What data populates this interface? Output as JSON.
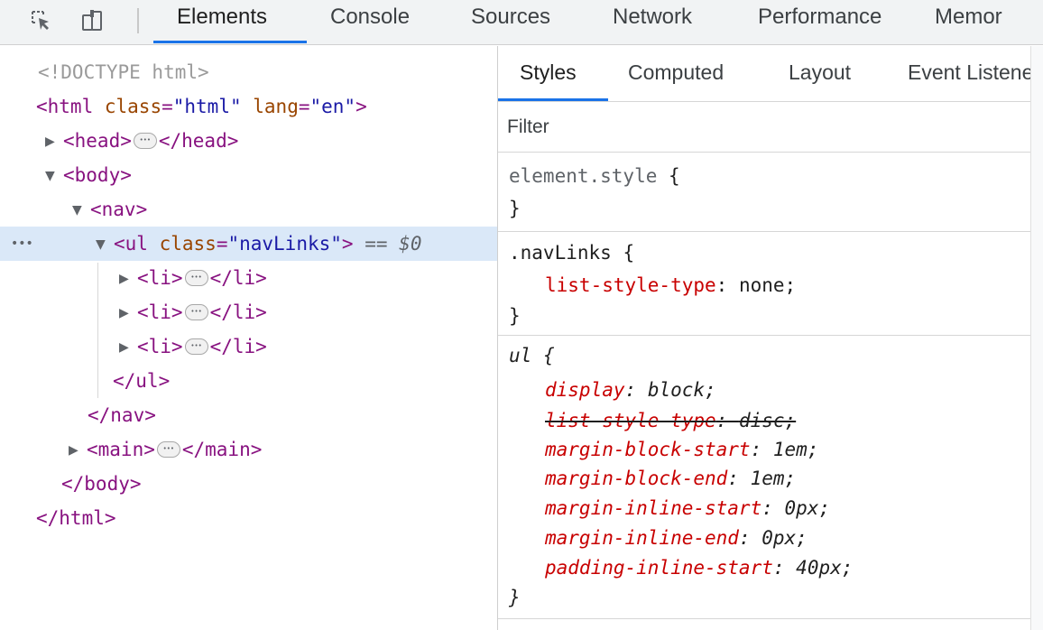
{
  "toolbar": {
    "tabs": [
      {
        "label": "Elements",
        "active": true
      },
      {
        "label": "Console"
      },
      {
        "label": "Sources"
      },
      {
        "label": "Network"
      },
      {
        "label": "Performance"
      },
      {
        "label": "Memor"
      }
    ],
    "icons": [
      "inspect-element-icon",
      "device-toolbar-icon"
    ]
  },
  "dom": {
    "doctype": "<!DOCTYPE html>",
    "html_open_tag": "<html",
    "html_attr_class": "class",
    "html_class_val": "\"html\"",
    "html_attr_lang": "lang",
    "html_lang_val": "\"en\"",
    "gt": ">",
    "head_open": "<head>",
    "head_close": "</head>",
    "body_open": "<body>",
    "nav_open": "<nav>",
    "ul_open": "<ul",
    "ul_attr_class": "class",
    "ul_class_val": "\"navLinks\"",
    "selected_marker_eq": "==",
    "selected_marker_var": "$0",
    "li_open": "<li>",
    "li_close": "</li>",
    "ul_close": "</ul>",
    "nav_close": "</nav>",
    "main_open": "<main>",
    "main_close": "</main>",
    "body_close": "</body>",
    "html_close": "</html>",
    "gutter_dots": "•••"
  },
  "styles": {
    "subtabs": [
      {
        "label": "Styles",
        "active": true
      },
      {
        "label": "Computed"
      },
      {
        "label": "Layout"
      },
      {
        "label": "Event Listeners"
      }
    ],
    "filter_placeholder": "Filter",
    "rules": {
      "element_style_selector": "element.style",
      "open_brace": "{",
      "close_brace": "}",
      "navlinks_selector": ".navLinks",
      "navlinks_prop": "list-style-type",
      "navlinks_val": "none;",
      "ul_selector": "ul",
      "ul_props": [
        {
          "name": "display",
          "value": "block;",
          "struck": false
        },
        {
          "name": "list-style-type",
          "value": "disc;",
          "struck": true
        },
        {
          "name": "margin-block-start",
          "value": "1em;",
          "struck": false
        },
        {
          "name": "margin-block-end",
          "value": "1em;",
          "struck": false
        },
        {
          "name": "margin-inline-start",
          "value": "0px;",
          "struck": false
        },
        {
          "name": "margin-inline-end",
          "value": "0px;",
          "struck": false
        },
        {
          "name": "padding-inline-start",
          "value": "40px;",
          "struck": false
        }
      ]
    }
  },
  "colors": {
    "tag": "#881280",
    "attr_name": "#994500",
    "attr_value": "#1a1aa6",
    "css_property": "#c80000",
    "selection_bg": "#dae8f8",
    "active_tab_underline": "#1a73e8"
  }
}
